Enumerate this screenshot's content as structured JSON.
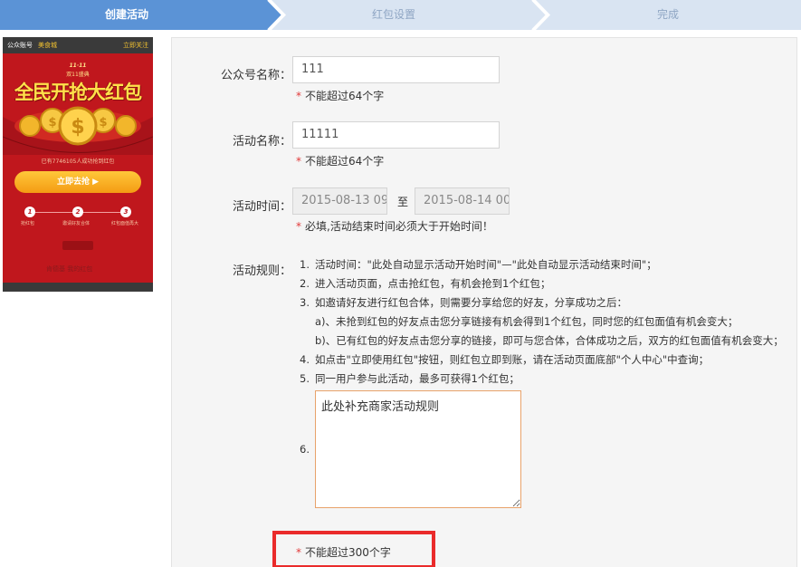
{
  "steps": [
    {
      "label": "创建活动",
      "state": "active"
    },
    {
      "label": "红包设置",
      "state": "inactive"
    },
    {
      "label": "完成",
      "state": "inactive"
    }
  ],
  "colors": {
    "step_active": "#5b93d6",
    "step_inactive": "#d9e4f2",
    "hint_star": "#e23a3a",
    "highlight_border": "#ea2b2b",
    "preview_bg": "#c0171d"
  },
  "preview": {
    "account_label": "公众账号",
    "mall_name": "美食城",
    "follow_label": "立即关注",
    "badge_top": "11·11",
    "badge_sub": "双11盛典",
    "headline": "全民开抢大红包",
    "count_text": "已有7746105人成功抢到红包",
    "grab_button": "立即去抢 ▶",
    "step_numbers": [
      "1",
      "2",
      "3"
    ],
    "step_labels": [
      "抢红包",
      "邀请好友合体",
      "红包面值再大"
    ],
    "footer_text": "肯德基  我的红包"
  },
  "form": {
    "account_name": {
      "label": "公众号名称：",
      "value": "111",
      "hint": "不能超过64个字"
    },
    "activity_name": {
      "label": "活动名称：",
      "value": "11111",
      "hint": "不能超过64个字"
    },
    "activity_time": {
      "label": "活动时间：",
      "start": "2015-08-13 09",
      "separator": "至",
      "end": "2015-08-14 00",
      "hint": "必填,活动结束时间必须大于开始时间！"
    },
    "rules": {
      "label": "活动规则：",
      "items": [
        {
          "num": "1.",
          "text": "活动时间：\"此处自动显示活动开始时间\"—\"此处自动显示活动结束时间\"；"
        },
        {
          "num": "2.",
          "text": "进入活动页面，点击抢红包，有机会抢到1个红包；"
        },
        {
          "num": "3.",
          "text": "如邀请好友进行红包合体，则需要分享给您的好友，分享成功之后："
        },
        {
          "num": "",
          "text": "a)、未抢到红包的好友点击您分享链接有机会得到1个红包，同时您的红包面值有机会变大；"
        },
        {
          "num": "",
          "text": "b)、已有红包的好友点击您分享的链接，即可与您合体，合体成功之后，双方的红包面值有机会变大；"
        },
        {
          "num": "4.",
          "text": "如点击\"立即使用红包\"按钮，则红包立即到账，请在活动页面底部\"个人中心\"中查询；"
        },
        {
          "num": "5.",
          "text": "同一用户参与此活动，最多可获得1个红包；"
        }
      ],
      "custom_num": "6.",
      "custom_value": "此处补充商家活动规则",
      "hint": "不能超过300个字"
    },
    "required_mark": "*"
  }
}
